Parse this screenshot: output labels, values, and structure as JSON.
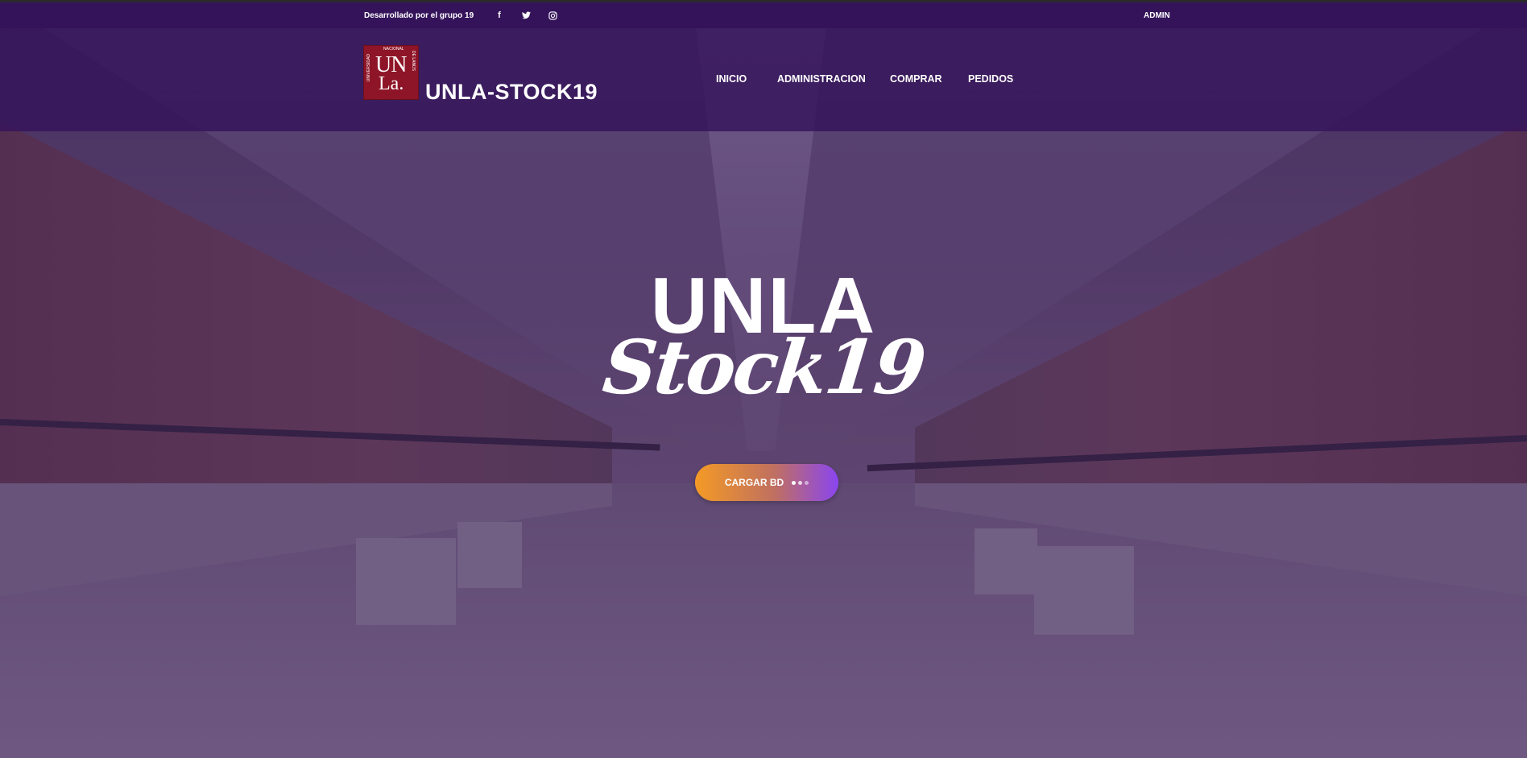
{
  "topbar": {
    "credit": "Desarrollado por el grupo 19",
    "social": [
      {
        "icon": "facebook-icon",
        "glyph": "f"
      },
      {
        "icon": "twitter-icon",
        "glyph": "🐦"
      },
      {
        "icon": "instagram-icon",
        "glyph": "◎"
      }
    ],
    "user": "ADMIN"
  },
  "header": {
    "logo": {
      "top": "NACIONAL",
      "left": "UNIVERSIDAD",
      "right": "DE LANÚS",
      "un": "UN",
      "la": "La."
    },
    "brand": "UNLA-STOCK19",
    "nav": [
      "INICIO",
      "ADMINISTRACION",
      "COMPRAR",
      "PEDIDOS"
    ]
  },
  "hero": {
    "title": "UNLA",
    "subtitle": "Stock19",
    "button": "CARGAR BD"
  },
  "colors": {
    "topbar": "#34135a",
    "header": "#34135a",
    "logo": "#8e1527",
    "button_start": "#f49a25",
    "button_end": "#8a45f0"
  }
}
